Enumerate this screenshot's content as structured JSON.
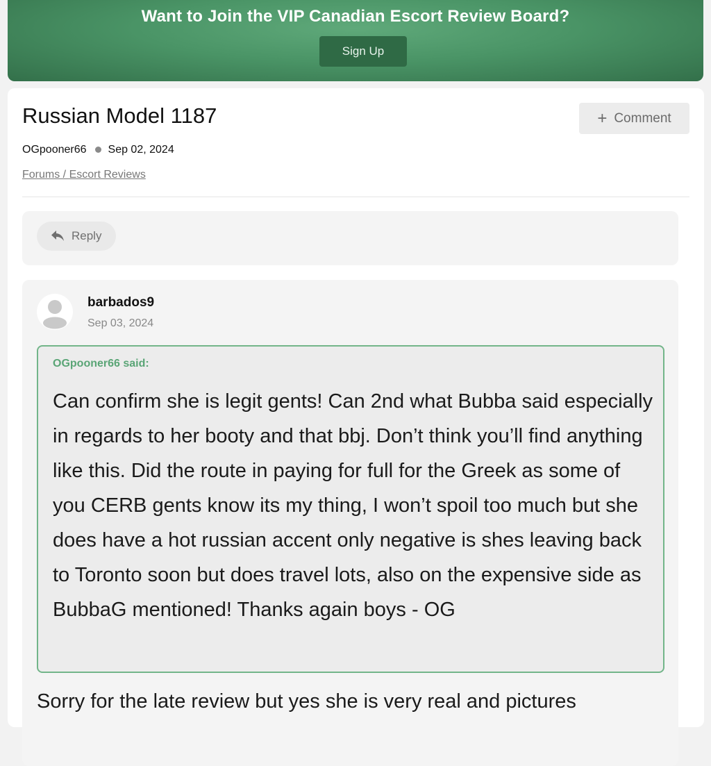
{
  "banner": {
    "title": "Want to Join the VIP Canadian Escort Review Board?",
    "signup_label": "Sign Up"
  },
  "thread": {
    "title": "Russian Model 1187",
    "comment_label": "Comment",
    "author": "OGpooner66",
    "date": "Sep 02, 2024",
    "breadcrumb": "Forums / Escort Reviews"
  },
  "reply": {
    "label": "Reply"
  },
  "post": {
    "author": "barbados9",
    "date": "Sep 03, 2024",
    "quote_attribution": "OGpooner66 said:",
    "quote_text": "Can confirm she is legit gents! Can 2nd what Bubba said especially in regards to her booty and that bbj. Don’t think you’ll find anything like this. Did the route in paying for full for the Greek as some of you CERB gents know its my thing, I won’t spoil too much but she does have a hot russian accent only negative is shes leaving back to Toronto soon but does travel lots, also on the expensive side as BubbaG mentioned! Thanks again boys - OG",
    "body_text": "Sorry for the late review but yes she is very real and pictures"
  },
  "colors": {
    "brand_green": "#4a9466",
    "quote_border": "#72b589"
  },
  "icons": {
    "comment": "plus-icon",
    "reply": "reply-arrow-icon",
    "avatar": "user-placeholder-icon"
  }
}
